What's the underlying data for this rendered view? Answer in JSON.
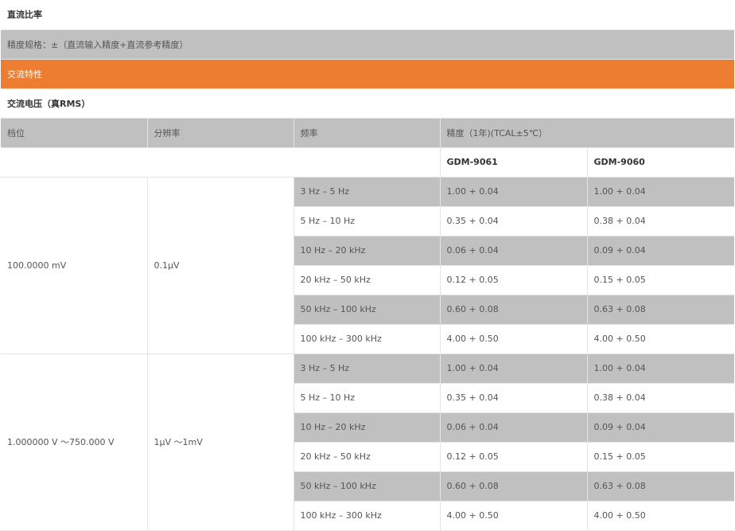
{
  "dc_ratio": {
    "title": "直流比率",
    "note": "精度规格：±（直流输入精度+直流参考精度）"
  },
  "ac": {
    "section_title": "交流特性",
    "subtitle": "交流电压（真RMS）",
    "headers": {
      "range": "档位",
      "resolution": "分辨率",
      "frequency": "频率",
      "accuracy": "精度（1年)(TCAL±5℃）"
    },
    "models": [
      "GDM-9061",
      "GDM-9060"
    ],
    "groups": [
      {
        "range": "100.0000 mV",
        "resolution": "0.1μV",
        "rows": [
          {
            "freq": "3 Hz – 5 Hz",
            "v1": "1.00 + 0.04",
            "v2": "1.00 + 0.04"
          },
          {
            "freq": "5 Hz – 10 Hz",
            "v1": "0.35 + 0.04",
            "v2": "0.38 + 0.04"
          },
          {
            "freq": "10 Hz – 20 kHz",
            "v1": "0.06 + 0.04",
            "v2": "0.09 + 0.04"
          },
          {
            "freq": "20 kHz – 50 kHz",
            "v1": "0.12 + 0.05",
            "v2": "0.15 + 0.05"
          },
          {
            "freq": "50 kHz – 100 kHz",
            "v1": "0.60 + 0.08",
            "v2": "0.63 + 0.08"
          },
          {
            "freq": "100 kHz – 300 kHz",
            "v1": "4.00 + 0.50",
            "v2": "4.00 + 0.50"
          }
        ]
      },
      {
        "range": "1.000000 V ～750.000 V",
        "resolution": "1μV ～1mV",
        "rows": [
          {
            "freq": "3 Hz – 5 Hz",
            "v1": "1.00 + 0.04",
            "v2": "1.00 + 0.04"
          },
          {
            "freq": "5 Hz – 10 Hz",
            "v1": "0.35 + 0.04",
            "v2": "0.38 + 0.04"
          },
          {
            "freq": "10 Hz – 20 kHz",
            "v1": "0.06 + 0.04",
            "v2": "0.09 + 0.04"
          },
          {
            "freq": "20 kHz – 50 kHz",
            "v1": "0.12 + 0.05",
            "v2": "0.15 + 0.05"
          },
          {
            "freq": "50 kHz – 100 kHz",
            "v1": "0.60 + 0.08",
            "v2": "0.63 + 0.08"
          },
          {
            "freq": "100 kHz – 300 kHz",
            "v1": "4.00 + 0.50",
            "v2": "4.00 + 0.50"
          }
        ]
      }
    ]
  },
  "colors": {
    "section_bg": "#ed7d31",
    "grey_row": "#c0c0c0",
    "border": "#e4e4e4"
  }
}
